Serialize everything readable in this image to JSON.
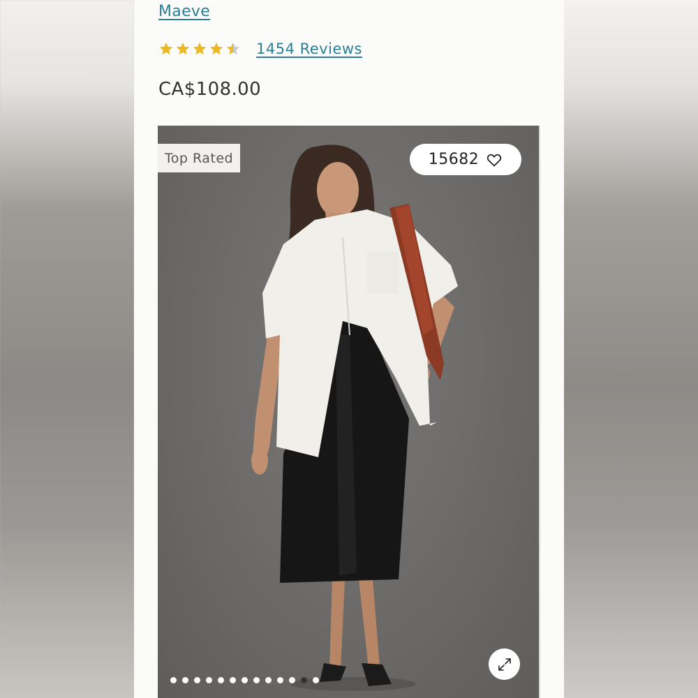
{
  "product": {
    "brand": "Maeve",
    "rating": 4.5,
    "rating_max": 5,
    "reviews_label": "1454 Reviews",
    "price": "CA$108.00"
  },
  "gallery": {
    "badge": "Top Rated",
    "likes": "15682",
    "total_images": 13,
    "active_index": 11
  },
  "colors": {
    "link": "#2a7f94",
    "star": "#e8b923",
    "star_empty": "#c9c9c9"
  },
  "icons": {
    "like": "heart-icon",
    "expand": "expand-icon"
  }
}
